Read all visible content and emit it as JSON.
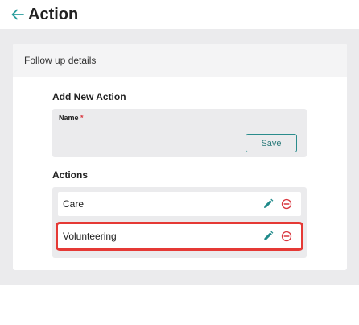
{
  "header": {
    "title": "Action",
    "back_icon": "arrow-left-icon",
    "accent_color": "#2a9d9d"
  },
  "card": {
    "title": "Follow up details"
  },
  "add_new": {
    "heading": "Add New Action",
    "name_label": "Name",
    "required_mark": "*",
    "name_value": "",
    "save_label": "Save"
  },
  "actions": {
    "heading": "Actions",
    "items": [
      {
        "label": "Care",
        "edit_icon": "pencil-icon",
        "remove_icon": "minus-circle-icon"
      },
      {
        "label": "Volunteering",
        "edit_icon": "pencil-icon",
        "remove_icon": "minus-circle-icon",
        "highlighted": true
      }
    ]
  },
  "colors": {
    "edit_icon": "#1f8a8a",
    "remove_icon": "#d9363e",
    "highlight_border": "#e53935",
    "panel_gray": "#ebebed"
  }
}
